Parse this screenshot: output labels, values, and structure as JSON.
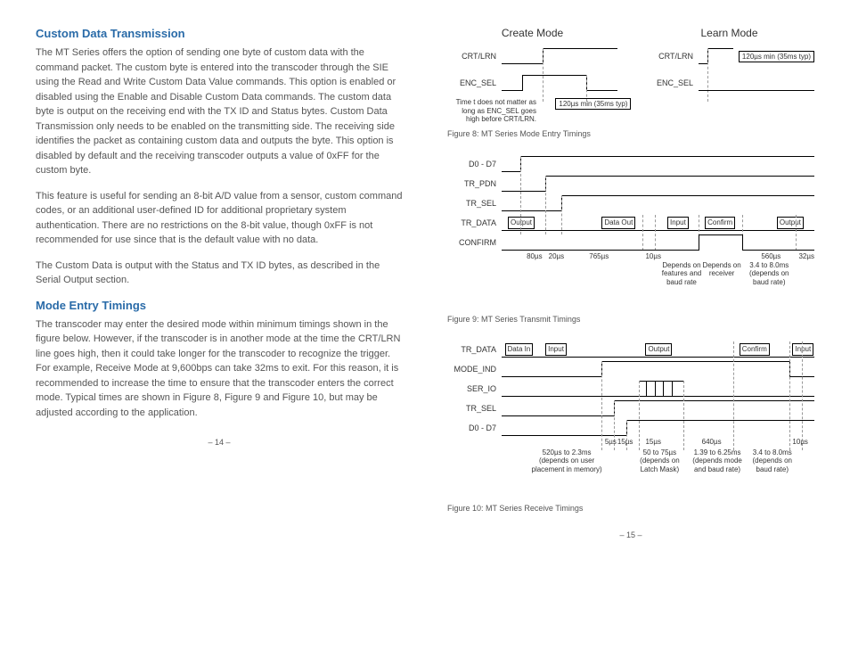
{
  "left": {
    "h1": "Custom Data Transmission",
    "p1": "The MT Series offers the option of sending one byte of custom data with the command packet. The custom byte is entered into the transcoder through the SIE using the Read and Write Custom Data Value commands. This option is enabled or disabled using the Enable and Disable Custom Data commands. The custom data byte is output on the receiving end with the TX ID and Status bytes. Custom Data Transmission only needs to be enabled on the transmitting side. The receiving side identifies the packet as containing custom data and outputs the byte. This option is disabled by default and the receiving transcoder outputs a value of 0xFF for the custom byte.",
    "p2": "This feature is useful for sending an 8-bit A/D value from a sensor, custom command codes, or an additional user-defined ID for additional proprietary system authentication. There are no restrictions on the 8-bit value, though 0xFF is not recommended for use since that is the default value with no data.",
    "p3": "The Custom Data is output with the Status and TX ID bytes, as described in the Serial Output section.",
    "h2": "Mode Entry Timings",
    "p4": "The transcoder may enter the desired mode within minimum timings shown in the figure below. However, if the transcoder is in another mode at the time the CRT/LRN line goes high, then it could take longer for the transcoder to recognize the trigger. For example, Receive Mode at 9,600bps can take 32ms to exit. For this reason, it is recommended to increase the time to ensure that the transcoder enters the correct mode. Typical times are shown in Figure 8, Figure 9 and Figure 10, but may be adjusted according to the application.",
    "page": "– 14 –"
  },
  "right": {
    "fig8": {
      "create": "Create Mode",
      "learn": "Learn Mode",
      "crtlrn": "CRT/LRN",
      "encsel": "ENC_SEL",
      "note": "Time t does not matter as long as ENC_SEL goes high before CRT/LRN.",
      "t1": "120µs min (35ms typ)",
      "t2": "120µs min (35ms typ)",
      "cap": "Figure 8: MT Series Mode Entry Timings"
    },
    "fig9": {
      "signals": {
        "d0d7": "D0 - D7",
        "trpdn": "TR_PDN",
        "trsel": "TR_SEL",
        "trdata": "TR_DATA",
        "confirm": "CONFIRM"
      },
      "boxes": {
        "output1": "Output",
        "dataout": "Data Out",
        "input": "Input",
        "confirm": "Confirm",
        "output2": "Output"
      },
      "times": {
        "t1": "80µs",
        "t2": "20µs",
        "t3": "765µs",
        "t4": "10µs",
        "t5": "560µs",
        "t6": "32µs",
        "n1": "Depends on features and baud rate",
        "n2": "Depends on receiver",
        "n3": "3.4 to 8.0ms (depends on baud rate)"
      },
      "cap": "Figure 9: MT Series Transmit Timings"
    },
    "fig10": {
      "signals": {
        "trdata": "TR_DATA",
        "modeind": "MODE_IND",
        "serio": "SER_IO",
        "trsel": "TR_SEL",
        "d0d7": "D0 - D7"
      },
      "boxes": {
        "datain": "Data In",
        "input1": "Input",
        "output": "Output",
        "confirm": "Confirm",
        "input2": "Input"
      },
      "times": {
        "t1": "5µs",
        "t2": "15µs",
        "t3": "15µs",
        "t4": "640µs",
        "t5": "10µs",
        "n1": "520µs to 2.3ms (depends on user placement in memory)",
        "n2": "50 to 75µs (depends on Latch Mask)",
        "n3": "1.39 to 6.25ms (depends mode and baud rate)",
        "n4": "3.4 to 8.0ms (depends on baud rate)"
      },
      "cap": "Figure 10: MT Series Receive Timings"
    },
    "page": "– 15 –"
  }
}
